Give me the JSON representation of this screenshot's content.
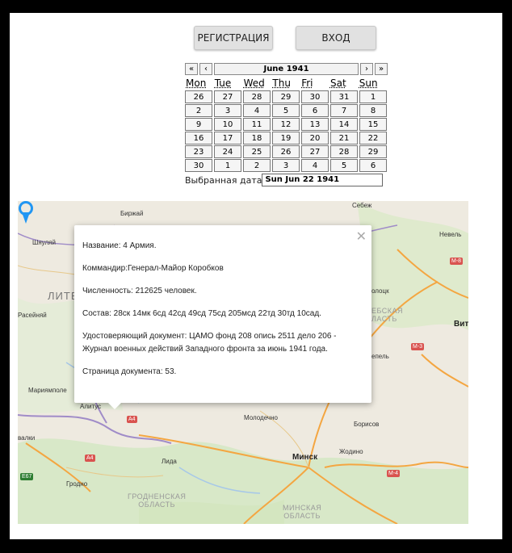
{
  "buttons": {
    "register": "РЕГИСТРАЦИЯ",
    "login": "ВХОД"
  },
  "calendar": {
    "prev_year": "«",
    "prev_month": "‹",
    "title": "June 1941",
    "next_month": "›",
    "next_year": "»",
    "weekdays": [
      "Mon",
      "Tue",
      "Wed",
      "Thu",
      "Fri",
      "Sat",
      "Sun"
    ],
    "days": [
      "26",
      "27",
      "28",
      "29",
      "30",
      "31",
      "1",
      "2",
      "3",
      "4",
      "5",
      "6",
      "7",
      "8",
      "9",
      "10",
      "11",
      "12",
      "13",
      "14",
      "15",
      "16",
      "17",
      "18",
      "19",
      "20",
      "21",
      "22",
      "23",
      "24",
      "25",
      "26",
      "27",
      "28",
      "29",
      "30",
      "1",
      "2",
      "3",
      "4",
      "5",
      "6"
    ]
  },
  "selected": {
    "label": "Выбранная дата",
    "value": "Sun Jun 22 1941"
  },
  "popup": {
    "name": "Название: 4 Армия.",
    "commander": "Коммандир:Генерал-Майор Коробков",
    "strength": "Численность: 212625 человек.",
    "composition": "Состав: 28ск 14мк 6сд 42сд 49сд 75сд 205мсд 22тд 30тд 10сад.",
    "document": "Удостоверяющий документ: ЦАМО фонд 208 опись 2511 дело 206 - Журнал военных действий Западного фронта за июнь 1941 года.",
    "page": "Страница документа: 53."
  },
  "map": {
    "labels": {
      "birzhai": "Биржай",
      "sebezh": "Себеж",
      "shyaulyai": "Шяуляй",
      "nevel": "Невель",
      "litva": "ЛИТВ",
      "raseiniai": "Расейняй",
      "polotsk": "олоцк",
      "vitebsk_region": "ЕБСКАЯ\nЛАСТЬ",
      "vitebsk": "Вите",
      "lepel": "епель",
      "marijampole": "Мариямполе",
      "alitus": "Алитус",
      "molodechno": "Молодечно",
      "borisov": "Борисов",
      "zhodino": "Жодино",
      "minsk": "Минск",
      "suvalki": "валки",
      "lida": "Лида",
      "grodno": "Гродно",
      "grodno_region": "ГРОДНЕНСКАЯ\nОБЛАСТЬ",
      "minsk_region": "МИНСКАЯ\nОБЛАСТЬ"
    },
    "shields": {
      "m8": "M-8",
      "m3": "M-3",
      "a4a": "A4",
      "a4b": "A4",
      "m4": "M-4",
      "e67": "E67"
    },
    "pin_color": "#2196f3"
  }
}
